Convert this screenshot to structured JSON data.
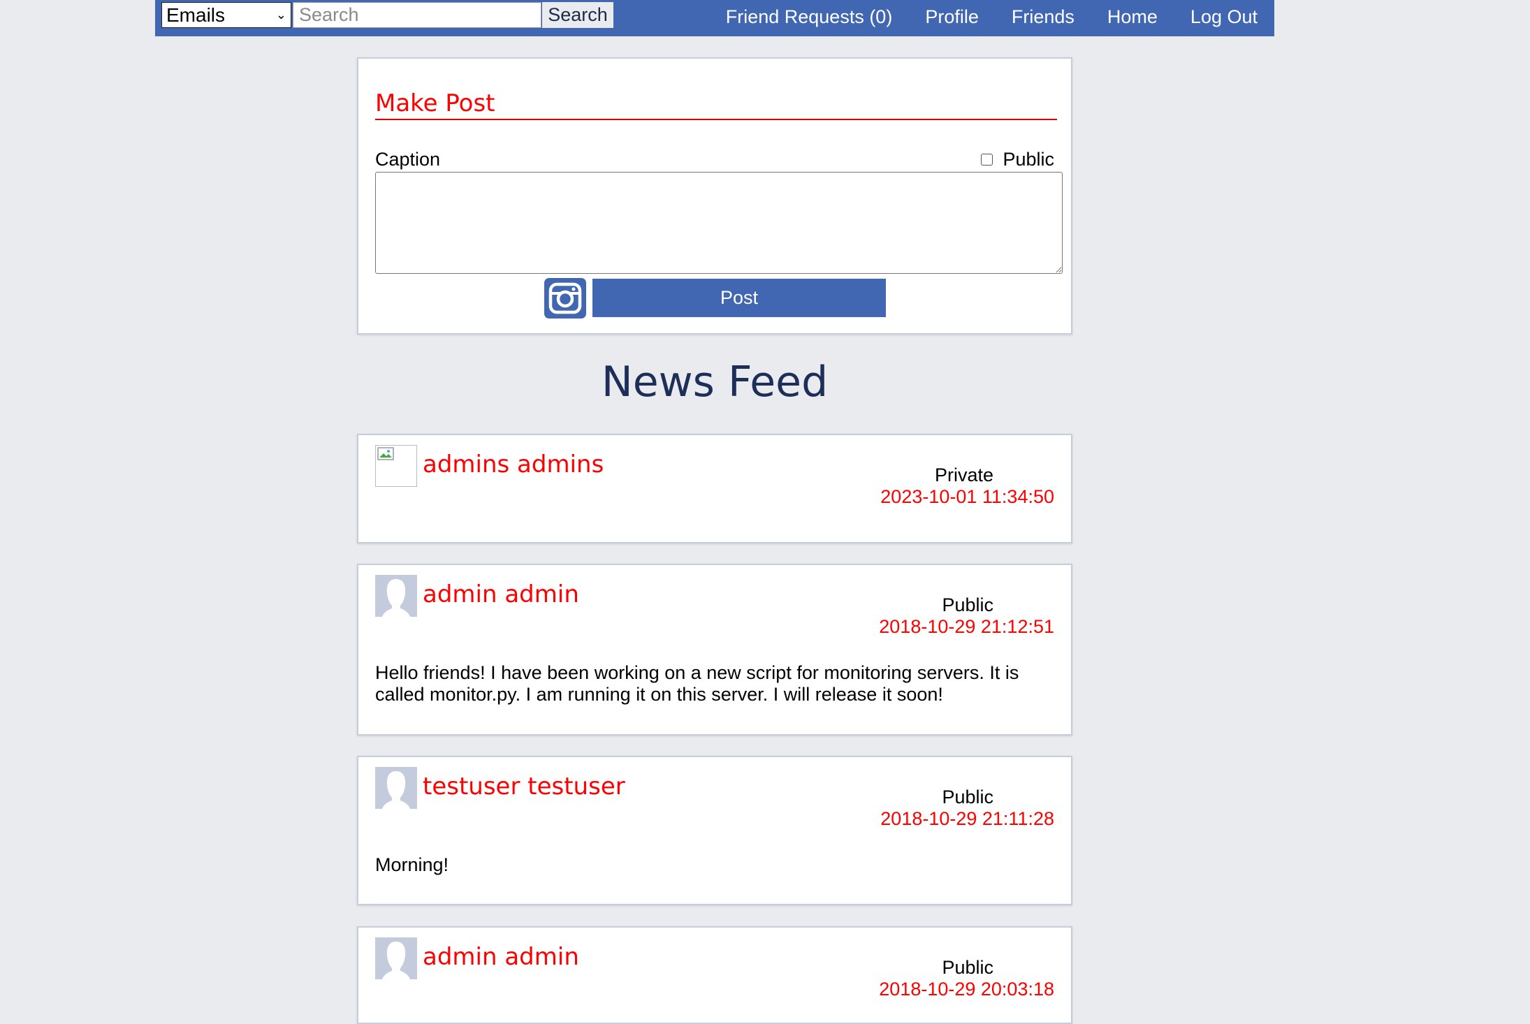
{
  "header": {
    "search_type": "Emails",
    "search_placeholder": "Search",
    "search_button": "Search",
    "nav": [
      "Friend Requests (0)",
      "Profile",
      "Friends",
      "Home",
      "Log Out"
    ]
  },
  "make_post": {
    "title": "Make Post",
    "caption_label": "Caption",
    "public_label": "Public",
    "public_checked": false,
    "post_button": "Post"
  },
  "feed": {
    "title": "News Feed",
    "posts": [
      {
        "author": "admins admins",
        "visibility": "Private",
        "date": "2023-10-01 11:34:50",
        "body": "",
        "avatar": "broken-image"
      },
      {
        "author": "admin admin",
        "visibility": "Public",
        "date": "2018-10-29 21:12:51",
        "body": "Hello friends! I have been working on a new script for monitoring servers. It is called monitor.py. I am running it on this server. I will release it soon!",
        "avatar": "default-avatar"
      },
      {
        "author": "testuser testuser",
        "visibility": "Public",
        "date": "2018-10-29 21:11:28",
        "body": "Morning!",
        "avatar": "default-avatar"
      },
      {
        "author": "admin admin",
        "visibility": "Public",
        "date": "2018-10-29 20:03:18",
        "body": "",
        "avatar": "default-avatar"
      }
    ]
  },
  "colors": {
    "brand": "#4267b2",
    "accent_red": "#ff0000",
    "page_bg": "#e9ebee"
  }
}
